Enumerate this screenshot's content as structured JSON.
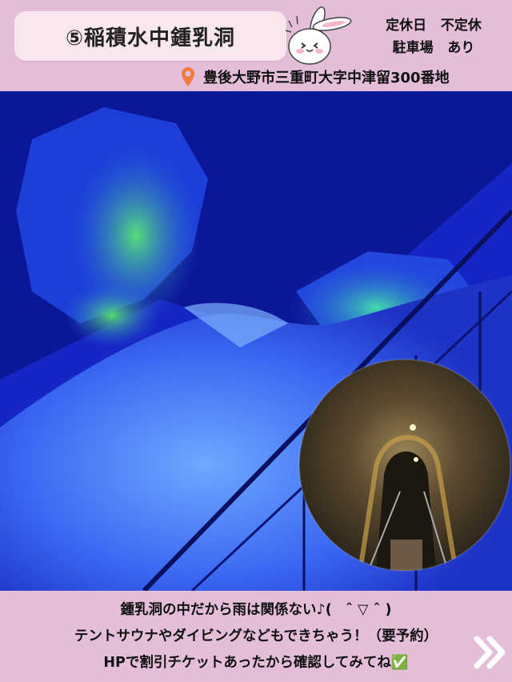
{
  "header": {
    "title": "⑤稲積水中鍾乳洞",
    "info": {
      "closed_label": "定休日",
      "closed_value": "不定休",
      "parking_label": "駐車場",
      "parking_value": "あり"
    },
    "address": "豊後大野市三重町大字中津留300番地",
    "pin_icon": "location-pin-icon",
    "pin_color": "#f07b3f"
  },
  "photo": {
    "main": "blue-lit-cave-interior",
    "inset": "cave-tunnel-walkway"
  },
  "footer": {
    "lines": [
      "鍾乳洞の中だから雨は関係ない♪(　ˆ ▽ ˆ )",
      "テントサウナやダイビングなどもできちゃう！（要予約）",
      "HPで割引チケットあったから確認してみてね✅"
    ],
    "next_icon": "double-chevron-right-icon"
  },
  "colors": {
    "background": "#e4bed9",
    "title_pill": "#f8e7ee",
    "cave_blue": "#2b3ff0",
    "cave_green": "#3ee86a"
  }
}
